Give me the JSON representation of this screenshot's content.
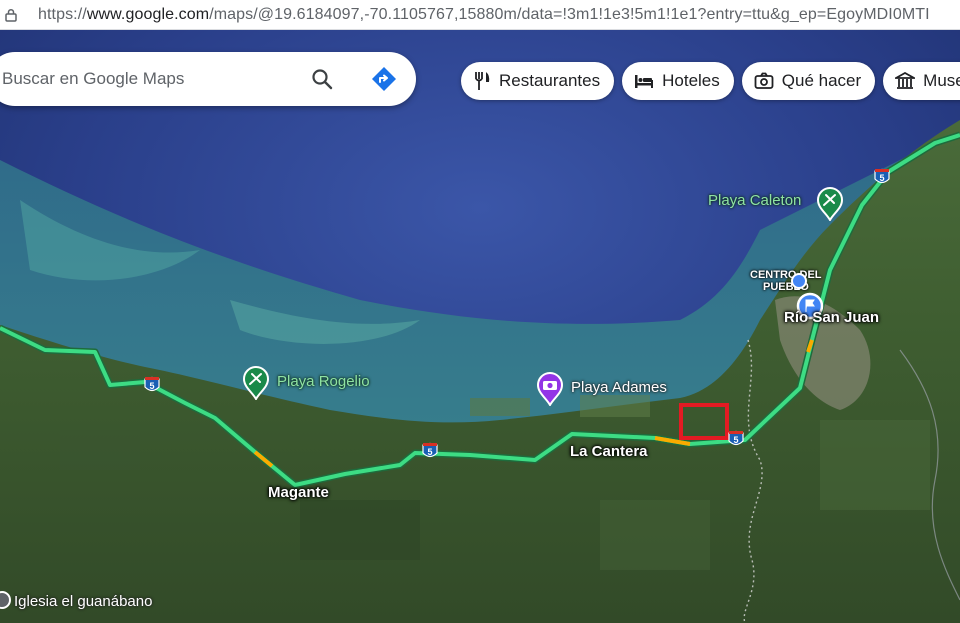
{
  "browser": {
    "url_prefix": "https://",
    "url_host": "www.google.com",
    "url_path": "/maps/@19.6184097,-70.1105767,15880m/data=!3m1!1e3!5m1!1e1?entry=ttu&g_ep=EgoyMDI0MTI"
  },
  "search": {
    "placeholder": "Buscar en Google Maps",
    "search_icon": "magnifier-icon",
    "directions_icon": "directions-diamond-icon"
  },
  "chips": [
    {
      "label": "Restaurantes",
      "icon": "fork-knife-icon"
    },
    {
      "label": "Hoteles",
      "icon": "bed-icon"
    },
    {
      "label": "Qué hacer",
      "icon": "camera-icon"
    },
    {
      "label": "Museos",
      "icon": "museum-icon"
    }
  ],
  "places": {
    "playa_caleton": "Playa Caleton",
    "playa_rogelio": "Playa Rogelio",
    "playa_adames": "Playa Adames",
    "rio_san_juan": "Río San Juan",
    "centro_line1": "CENTRO DEL",
    "centro_line2": "PUEBLO",
    "la_cantera": "La Cantera",
    "magante": "Magante",
    "iglesia": "Iglesia el guanábano"
  },
  "road": {
    "shield_number": "5",
    "traffic_color": "#3ddc84",
    "slow_color": "#f9ab00"
  },
  "colors": {
    "beach_pin": "#1a8a4a",
    "attraction_pin": "#9334e6",
    "location_blue": "#4285f4",
    "highlight_box": "#e31b23"
  }
}
